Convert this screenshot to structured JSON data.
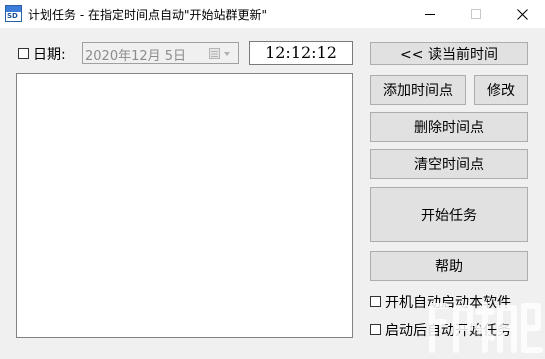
{
  "window": {
    "title": "计划任务 - 在指定时间点自动\"开始站群更新\"",
    "icon_text": "SD",
    "controls": [
      "minimize-icon",
      "maximize-icon",
      "close-icon"
    ]
  },
  "form": {
    "date_checkbox_label": "日期:",
    "date_value": "2020年12月  5日",
    "time_value": "12:12:12"
  },
  "buttons": {
    "read_time": "<<  读当前时间",
    "add_time": "添加时间点",
    "modify": "修改",
    "delete_time": "删除时间点",
    "clear_time": "清空时间点",
    "start_task": "开始任务",
    "help": "帮助"
  },
  "options": {
    "autostart": "开机自动启动本软件",
    "autostart_task": "启动后自动开始任务"
  },
  "time_points": [],
  "colors": {
    "window_bg": "#f0f0f0",
    "button_bg": "#e1e1e1",
    "button_border": "#adadad",
    "disabled_text": "#8c8c8c"
  }
}
